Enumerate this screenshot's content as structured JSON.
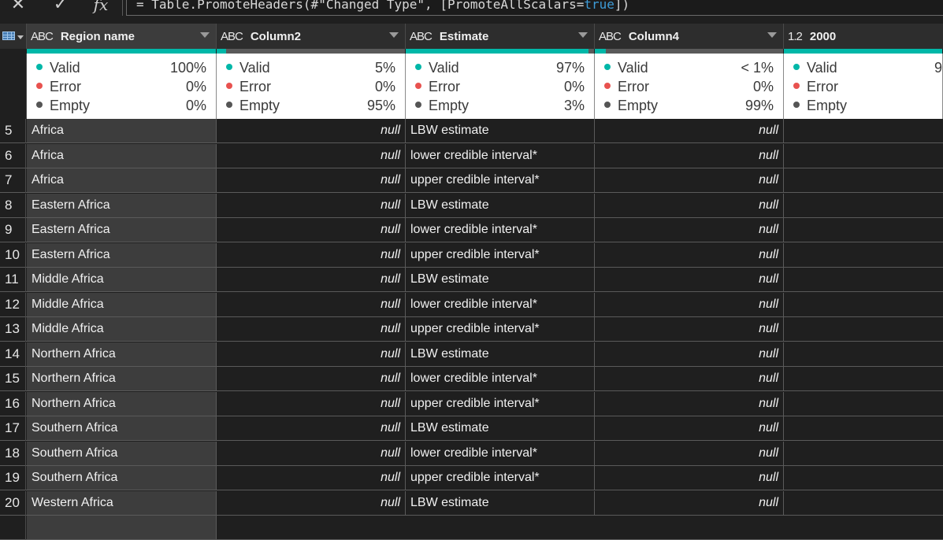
{
  "formula_bar": {
    "cancel_glyph": "✕",
    "confirm_glyph": "✓",
    "fx_glyph": "fx",
    "formula_prefix": "= Table.PromoteHeaders(#\"Changed Type\", [PromoteAllScalars=",
    "formula_keyword": "true",
    "formula_suffix": "])"
  },
  "columns": [
    {
      "type_icon": "ABC",
      "name": "Region name",
      "has_dropdown": true
    },
    {
      "type_icon": "ABC",
      "name": "Column2",
      "has_dropdown": true
    },
    {
      "type_icon": "ABC",
      "name": "Estimate",
      "has_dropdown": true
    },
    {
      "type_icon": "ABC",
      "name": "Column4",
      "has_dropdown": true
    },
    {
      "type_icon": "1.2",
      "name": "2000",
      "has_dropdown": false
    }
  ],
  "quality": [
    {
      "valid": "100%",
      "error": "0%",
      "empty": "0%",
      "bar_valid_fraction": 1.0
    },
    {
      "valid": "5%",
      "error": "0%",
      "empty": "95%",
      "bar_valid_fraction": 0.05
    },
    {
      "valid": "97%",
      "error": "0%",
      "empty": "3%",
      "bar_valid_fraction": 0.97
    },
    {
      "valid": "< 1%",
      "error": "0%",
      "empty": "99%",
      "bar_valid_fraction": 0.06
    },
    {
      "valid": "9",
      "error": "",
      "empty": "",
      "bar_valid_fraction": 1.0
    }
  ],
  "quality_labels": {
    "valid": "Valid",
    "error": "Error",
    "empty": "Empty"
  },
  "colors": {
    "valid": "#00b7a8",
    "error": "#e8524f",
    "empty": "#5a5a5a",
    "header_bg": "#2d2d2d",
    "cell_bg": "#1f1f1f",
    "selected_col_bg": "#3d3d3d"
  },
  "rows": [
    {
      "n": "5",
      "region": "Africa",
      "col2": "null",
      "estimate": "LBW estimate",
      "col4": "null"
    },
    {
      "n": "6",
      "region": "Africa",
      "col2": "null",
      "estimate": "lower credible interval*",
      "col4": "null"
    },
    {
      "n": "7",
      "region": "Africa",
      "col2": "null",
      "estimate": "upper credible interval*",
      "col4": "null"
    },
    {
      "n": "8",
      "region": "Eastern Africa",
      "col2": "null",
      "estimate": "LBW estimate",
      "col4": "null"
    },
    {
      "n": "9",
      "region": "Eastern Africa",
      "col2": "null",
      "estimate": "lower credible interval*",
      "col4": "null"
    },
    {
      "n": "10",
      "region": "Eastern Africa",
      "col2": "null",
      "estimate": "upper credible interval*",
      "col4": "null"
    },
    {
      "n": "11",
      "region": "Middle Africa",
      "col2": "null",
      "estimate": "LBW estimate",
      "col4": "null"
    },
    {
      "n": "12",
      "region": "Middle Africa",
      "col2": "null",
      "estimate": "lower credible interval*",
      "col4": "null"
    },
    {
      "n": "13",
      "region": "Middle Africa",
      "col2": "null",
      "estimate": "upper credible interval*",
      "col4": "null"
    },
    {
      "n": "14",
      "region": "Northern Africa",
      "col2": "null",
      "estimate": "LBW estimate",
      "col4": "null"
    },
    {
      "n": "15",
      "region": "Northern Africa",
      "col2": "null",
      "estimate": "lower credible interval*",
      "col4": "null"
    },
    {
      "n": "16",
      "region": "Northern Africa",
      "col2": "null",
      "estimate": "upper credible interval*",
      "col4": "null"
    },
    {
      "n": "17",
      "region": "Southern Africa",
      "col2": "null",
      "estimate": "LBW estimate",
      "col4": "null"
    },
    {
      "n": "18",
      "region": "Southern Africa",
      "col2": "null",
      "estimate": "lower credible interval*",
      "col4": "null"
    },
    {
      "n": "19",
      "region": "Southern Africa",
      "col2": "null",
      "estimate": "upper credible interval*",
      "col4": "null"
    },
    {
      "n": "20",
      "region": "Western Africa",
      "col2": "null",
      "estimate": "LBW estimate",
      "col4": "null"
    }
  ]
}
